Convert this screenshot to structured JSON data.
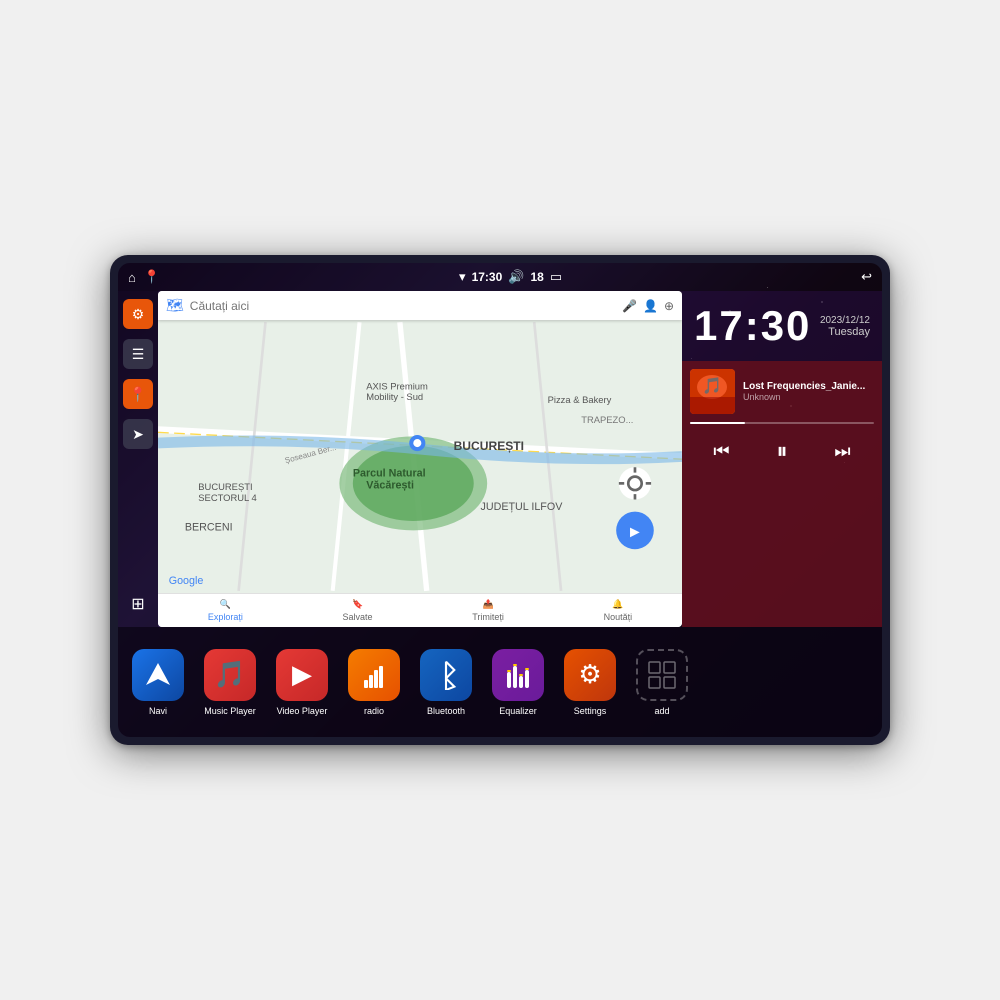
{
  "device": {
    "status_bar": {
      "wifi_icon": "▾",
      "time": "17:30",
      "volume_icon": "🔊",
      "battery_level": "18",
      "battery_icon": "▭",
      "back_icon": "↩",
      "home_icon": "⌂",
      "maps_icon": "📍"
    },
    "clock": {
      "time": "17:30",
      "date": "2023/12/12",
      "day": "Tuesday"
    },
    "music": {
      "title": "Lost Frequencies_Janie...",
      "artist": "Unknown",
      "prev_label": "⏮",
      "play_label": "⏸",
      "next_label": "⏭"
    },
    "map": {
      "search_placeholder": "Căutați aici",
      "locations": [
        "AXIS Premium Mobility - Sud",
        "Parcul Natural Văcărești",
        "Pizza & Bakery",
        "BUCUREȘTI",
        "JUDEȚUL ILFOV",
        "BERCENI",
        "BUCUREȘTI SECTORUL 4"
      ],
      "bottom_nav": [
        {
          "label": "Explorați",
          "icon": "🔍"
        },
        {
          "label": "Salvate",
          "icon": "🔖"
        },
        {
          "label": "Trimiteți",
          "icon": "📤"
        },
        {
          "label": "Noutăți",
          "icon": "🔔"
        }
      ]
    },
    "apps": [
      {
        "id": "navi",
        "label": "Navi",
        "icon_type": "navi"
      },
      {
        "id": "music-player",
        "label": "Music Player",
        "icon_type": "music"
      },
      {
        "id": "video-player",
        "label": "Video Player",
        "icon_type": "video"
      },
      {
        "id": "radio",
        "label": "radio",
        "icon_type": "radio"
      },
      {
        "id": "bluetooth",
        "label": "Bluetooth",
        "icon_type": "bluetooth"
      },
      {
        "id": "equalizer",
        "label": "Equalizer",
        "icon_type": "equalizer"
      },
      {
        "id": "settings",
        "label": "Settings",
        "icon_type": "settings"
      },
      {
        "id": "add",
        "label": "add",
        "icon_type": "add"
      }
    ],
    "sidebar": [
      {
        "id": "settings",
        "icon": "⚙",
        "type": "orange"
      },
      {
        "id": "files",
        "icon": "☰",
        "type": "dark"
      },
      {
        "id": "maps",
        "icon": "📍",
        "type": "orange"
      },
      {
        "id": "navigation",
        "icon": "➤",
        "type": "dark"
      }
    ]
  }
}
